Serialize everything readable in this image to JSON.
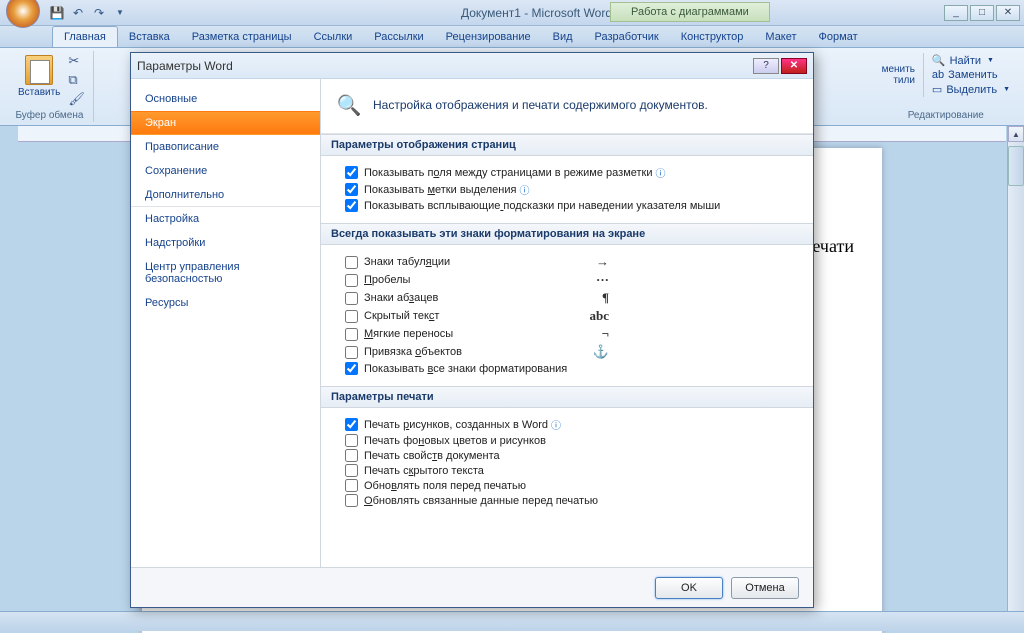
{
  "app": {
    "title": "Документ1 - Microsoft Word",
    "context_tab": "Работа с диаграммами"
  },
  "ribbon": {
    "tabs": [
      "Главная",
      "Вставка",
      "Разметка страницы",
      "Ссылки",
      "Рассылки",
      "Рецензирование",
      "Вид",
      "Разработчик",
      "Конструктор",
      "Макет",
      "Формат"
    ],
    "active": 0,
    "paste": "Вставить",
    "group_clipboard": "Буфер обмена",
    "editing": {
      "find": "Найти",
      "replace": "Заменить",
      "select": "Выделить",
      "group": "Редактирование"
    },
    "styles_frag1": "менить",
    "styles_frag2": "тили"
  },
  "doc": {
    "visible_text": "печати"
  },
  "dialog": {
    "title": "Параметры Word",
    "nav": [
      "Основные",
      "Экран",
      "Правописание",
      "Сохранение",
      "Дополнительно",
      "Настройка",
      "Надстройки",
      "Центр управления безопасностью",
      "Ресурсы"
    ],
    "nav_selected": 1,
    "header": "Настройка отображения и печати содержимого документов.",
    "sections": {
      "page_display": {
        "title": "Параметры отображения страниц",
        "opts": [
          {
            "label": "Показывать поля между страницами в режиме разметки",
            "checked": true,
            "info": true,
            "u": [
              12,
              13
            ]
          },
          {
            "label": "Показывать метки выделения",
            "checked": true,
            "info": true,
            "u": [
              11,
              12
            ]
          },
          {
            "label": "Показывать всплывающие подсказки при наведении указателя мыши",
            "checked": true,
            "u": [
              22,
              23
            ]
          }
        ]
      },
      "formatting": {
        "title": "Всегда показывать эти знаки форматирования на экране",
        "opts": [
          {
            "label": "Знаки табуляции",
            "checked": false,
            "sym": "→",
            "u": [
              11,
              12
            ]
          },
          {
            "label": "Пробелы",
            "checked": false,
            "sym": "···",
            "u": [
              0,
              1
            ]
          },
          {
            "label": "Знаки абзацев",
            "checked": false,
            "sym": "¶",
            "u": [
              8,
              9
            ]
          },
          {
            "label": "Скрытый текст",
            "checked": false,
            "sym": "abc",
            "u": [
              11,
              12
            ]
          },
          {
            "label": "Мягкие переносы",
            "checked": false,
            "sym": "¬",
            "u": [
              0,
              1
            ]
          },
          {
            "label": "Привязка объектов",
            "checked": false,
            "sym": "⚓",
            "u": [
              9,
              10
            ]
          },
          {
            "label": "Показывать все знаки форматирования",
            "checked": true,
            "u": [
              11,
              12
            ]
          }
        ]
      },
      "printing": {
        "title": "Параметры печати",
        "opts": [
          {
            "label": "Печать рисунков, созданных в Word",
            "checked": true,
            "info": true,
            "u": [
              7,
              8
            ]
          },
          {
            "label": "Печать фоновых цветов и рисунков",
            "checked": false,
            "u": [
              9,
              10
            ]
          },
          {
            "label": "Печать свойств документа",
            "checked": false,
            "u": [
              12,
              13
            ]
          },
          {
            "label": "Печать скрытого текста",
            "checked": false,
            "u": [
              8,
              9
            ]
          },
          {
            "label": "Обновлять поля перед печатью",
            "checked": false,
            "u": [
              4,
              5
            ]
          },
          {
            "label": "Обновлять связанные данные перед печатью",
            "checked": false,
            "u": [
              0,
              1
            ]
          }
        ]
      }
    },
    "ok": "OK",
    "cancel": "Отмена"
  }
}
